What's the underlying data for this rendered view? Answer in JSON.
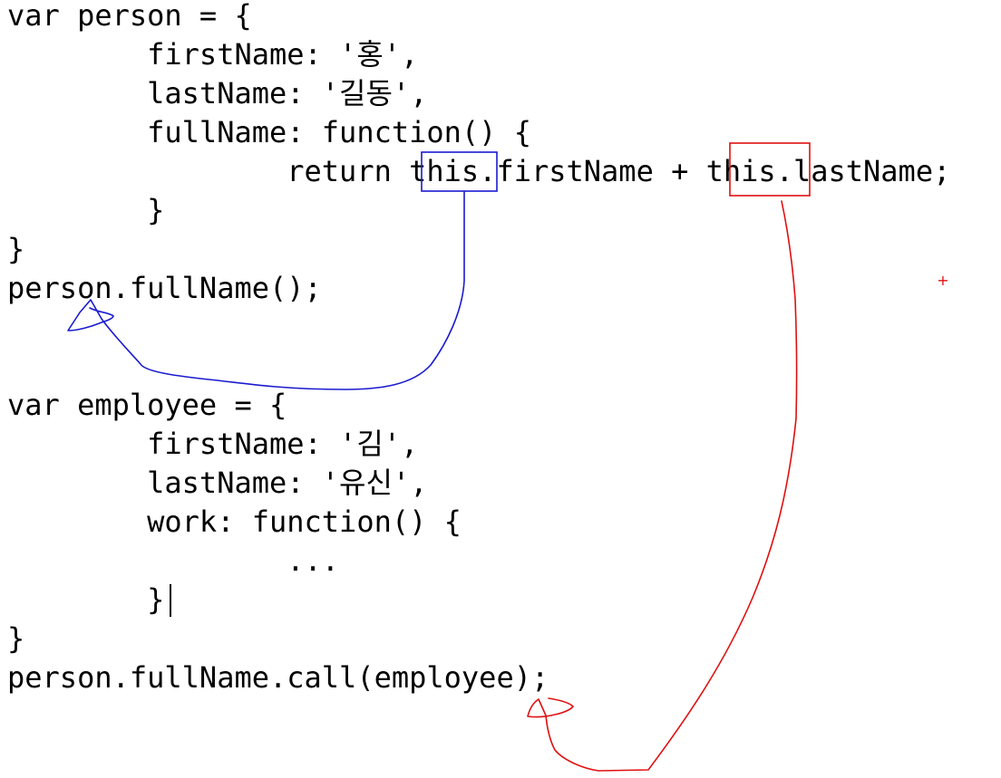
{
  "code": {
    "lines": [
      "var person = {",
      "        firstName: '홍',",
      "        lastName: '길동',",
      "        fullName: function() {",
      "                return this.firstName + this.lastName;",
      "        }",
      "}",
      "person.fullName();",
      "",
      "",
      "var employee = {",
      "        firstName: '김',",
      "        lastName: '유신',",
      "        work: function() {",
      "                ...",
      "        }",
      "}",
      "person.fullName.call(employee);"
    ]
  },
  "annotations": {
    "blue_color": "#1a1ad0",
    "red_color": "#e01010",
    "cursor_mark": "+"
  }
}
